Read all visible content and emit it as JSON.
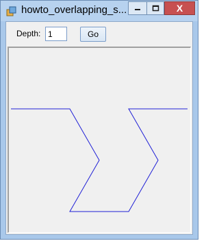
{
  "window": {
    "title": "howto_overlapping_s...",
    "close_glyph": "X",
    "icons": [
      "app-icon",
      "minimize-icon",
      "maximize-icon",
      "close-icon"
    ]
  },
  "controls": {
    "depth_label": "Depth:",
    "depth_value": "1",
    "go_label": "Go"
  },
  "drawing": {
    "line_color": "#1f1fd6"
  }
}
